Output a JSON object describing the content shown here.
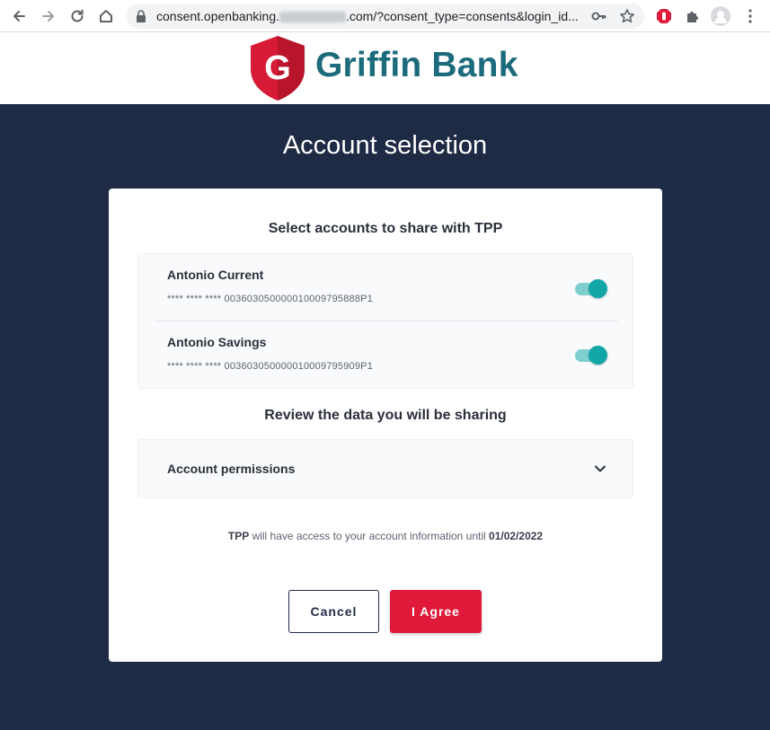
{
  "browser": {
    "url_prefix": "consent.openbanking.",
    "url_suffix": ".com/?consent_type=consents&login_id..."
  },
  "brand": {
    "logo_letter": "G",
    "name": "Griffin Bank",
    "brand_color": "#1b6b7c",
    "accent_color": "#e0193a",
    "background_color": "#1f2b45"
  },
  "page": {
    "title": "Account selection"
  },
  "accounts_section": {
    "title": "Select accounts to share with TPP",
    "accounts": [
      {
        "name": "Antonio Current",
        "number": "**** **** **** 003603050000010009795888P1",
        "selected": true
      },
      {
        "name": "Antonio Savings",
        "number": "**** **** **** 003603050000010009795909P1",
        "selected": true
      }
    ]
  },
  "review_section": {
    "title": "Review the data you will be sharing",
    "permissions_label": "Account permissions"
  },
  "access_note": {
    "party": "TPP",
    "text": "will have access to your account information until",
    "date": "01/02/2022"
  },
  "actions": {
    "cancel_label": "Cancel",
    "agree_label": "I Agree"
  }
}
